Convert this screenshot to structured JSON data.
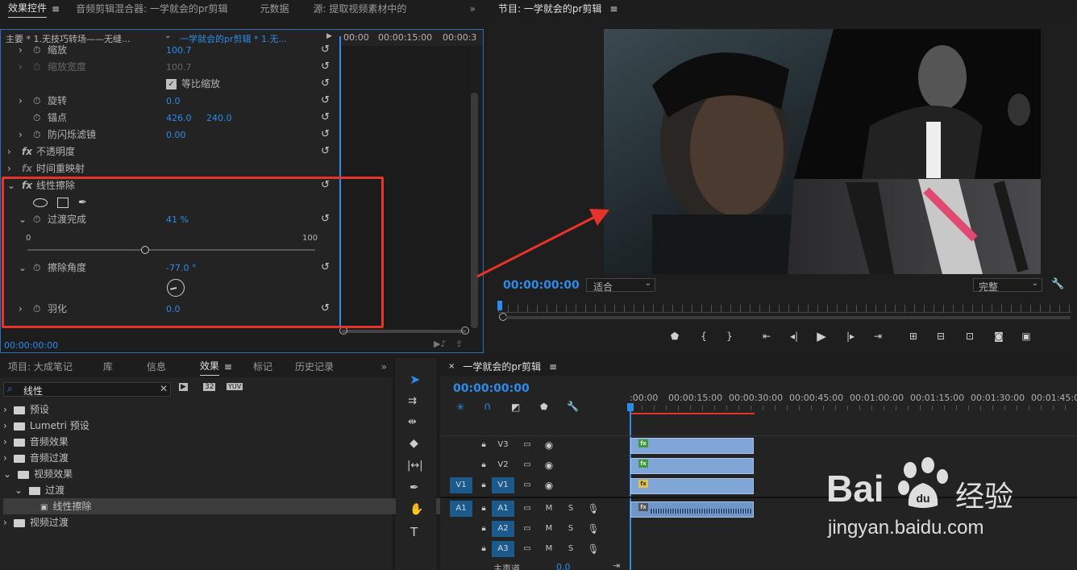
{
  "effect_controls": {
    "tabs": [
      "效果控件",
      "音频剪辑混合器: 一学就会的pr剪辑",
      "元数据",
      "源: 提取视频素材中的"
    ],
    "master_label": "主要 * 1.无技巧转场——无缝...",
    "sequence_label": "一学就会的pr剪辑 * 1.无...",
    "ruler_times": [
      "00:00",
      "00:00:15:00",
      "00:00:3"
    ],
    "rows": {
      "scale": {
        "label": "缩放",
        "value": "100.7"
      },
      "scale_width": {
        "label": "缩放宽度",
        "value": "100.7"
      },
      "uniform": {
        "label": "等比缩放"
      },
      "rotation": {
        "label": "旋转",
        "value": "0.0"
      },
      "anchor": {
        "label": "锚点",
        "value_x": "426.0",
        "value_y": "240.0"
      },
      "antiflicker": {
        "label": "防闪烁滤镜",
        "value": "0.00"
      },
      "opacity": {
        "label": "不透明度"
      },
      "time_remap": {
        "label": "时间重映射"
      },
      "linear_wipe": {
        "label": "线性擦除"
      },
      "transition_completion": {
        "label": "过渡完成",
        "value": "41 %",
        "min": "0",
        "max": "100",
        "fraction": 0.41
      },
      "wipe_angle": {
        "label": "擦除角度",
        "value": "-77.0 °"
      },
      "feather": {
        "label": "羽化",
        "value": "0.0"
      }
    },
    "timecode": "00:00:00:00"
  },
  "program_monitor": {
    "title": "节目: 一学就会的pr剪辑",
    "timecode": "00:00:00:00",
    "fit": "适合",
    "quality": "完整"
  },
  "project_panel": {
    "tabs": [
      "项目: 大成笔记",
      "库",
      "信息",
      "效果",
      "标记",
      "历史记录"
    ],
    "search_value": "线性",
    "items": [
      {
        "label": "预设"
      },
      {
        "label": "Lumetri 预设"
      },
      {
        "label": "音频效果"
      },
      {
        "label": "音频过渡"
      },
      {
        "label": "视频效果"
      },
      {
        "label": "过渡"
      },
      {
        "label": "线性擦除"
      },
      {
        "label": "视频过渡"
      }
    ]
  },
  "timeline": {
    "title": "一学就会的pr剪辑",
    "timecode": "00:00:00:00",
    "ruler": [
      ":00:00",
      "00:00:15:00",
      "00:00:30:00",
      "00:00:45:00",
      "00:01:00:00",
      "00:01:15:00",
      "00:01:30:00",
      "00:01:45:00"
    ],
    "tracks": [
      "V3",
      "V2",
      "V1",
      "A1",
      "A2",
      "A3"
    ],
    "src_v1": "V1",
    "src_a1": "A1",
    "m": "M",
    "s": "S",
    "master": "主声道",
    "master_value": "0.0"
  },
  "watermark": {
    "brand": "Bai",
    "brand2": "经验",
    "url": "jingyan.baidu.com"
  },
  "colors": {
    "accent_blue": "#2d8ceb",
    "highlight_red": "#e8332a",
    "clip_blue": "#7fa6d6"
  }
}
